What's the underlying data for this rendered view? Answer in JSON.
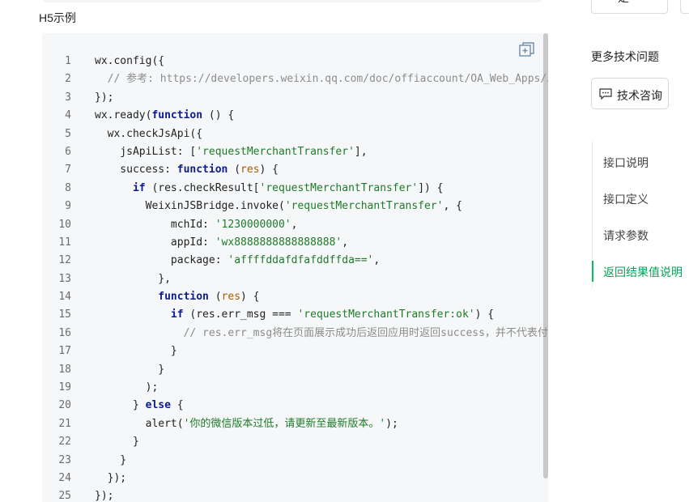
{
  "section": {
    "title": "H5示例"
  },
  "code": {
    "lines": [
      {
        "n": "1",
        "html": "<span class=\"pl\">wx.config({</span>"
      },
      {
        "n": "2",
        "html": "<span class=\"cmt\">  // 参考: https://developers.weixin.qq.com/doc/offiaccount/OA_Web_Apps/JS-SDK.html</span>"
      },
      {
        "n": "3",
        "html": "<span class=\"pl\">});</span>"
      },
      {
        "n": "4",
        "html": "<span class=\"pl\">wx.ready(</span><span class=\"kw\">function</span><span class=\"pl\"> () {</span>"
      },
      {
        "n": "5",
        "html": "<span class=\"pl\">  wx.checkJsApi({</span>"
      },
      {
        "n": "6",
        "html": "<span class=\"pl\">    jsApiList: [</span><span class=\"str\">'requestMerchantTransfer'</span><span class=\"pl\">],</span>"
      },
      {
        "n": "7",
        "html": "<span class=\"pl\">    success: </span><span class=\"kw\">function</span><span class=\"pl\"> (</span><span class=\"param\">res</span><span class=\"pl\">) {</span>"
      },
      {
        "n": "8",
        "html": "<span class=\"kw\">      if</span><span class=\"pl\"> (res.checkResult[</span><span class=\"str\">'requestMerchantTransfer'</span><span class=\"pl\">]) {</span>"
      },
      {
        "n": "9",
        "html": "<span class=\"pl\">        WeixinJSBridge.invoke(</span><span class=\"str\">'requestMerchantTransfer'</span><span class=\"pl\">, {</span>"
      },
      {
        "n": "10",
        "html": "<span class=\"pl\">            mchId: </span><span class=\"str\">'1230000000'</span><span class=\"pl\">,</span>"
      },
      {
        "n": "11",
        "html": "<span class=\"pl\">            appId: </span><span class=\"str\">'wx8888888888888888'</span><span class=\"pl\">,</span>"
      },
      {
        "n": "12",
        "html": "<span class=\"pl\">            package: </span><span class=\"str\">'affffddafdfafddffda=='</span><span class=\"pl\">,</span>"
      },
      {
        "n": "13",
        "html": "<span class=\"pl\">          },</span>"
      },
      {
        "n": "14",
        "html": "<span class=\"kw\">          function</span><span class=\"pl\"> (</span><span class=\"param\">res</span><span class=\"pl\">) {</span>"
      },
      {
        "n": "15",
        "html": "<span class=\"kw\">            if</span><span class=\"pl\"> (res.err_msg === </span><span class=\"str\">'requestMerchantTransfer:ok'</span><span class=\"pl\">) {</span>"
      },
      {
        "n": "16",
        "html": "<span class=\"cmt\">              // res.err_msg将在页面展示成功后返回应用时返回success，并不代表付款成功</span>"
      },
      {
        "n": "17",
        "html": "<span class=\"pl\">            }</span>"
      },
      {
        "n": "18",
        "html": "<span class=\"pl\">          }</span>"
      },
      {
        "n": "19",
        "html": "<span class=\"pl\">        );</span>"
      },
      {
        "n": "20",
        "html": "<span class=\"pl\">      } </span><span class=\"kw\">else</span><span class=\"pl\"> {</span>"
      },
      {
        "n": "21",
        "html": "<span class=\"pl\">        alert(</span><span class=\"str\">'你的微信版本过低，请更新至最新版本。'</span><span class=\"pl\">);</span>"
      },
      {
        "n": "22",
        "html": "<span class=\"pl\">      }</span>"
      },
      {
        "n": "23",
        "html": "<span class=\"pl\">    }</span>"
      },
      {
        "n": "24",
        "html": "<span class=\"pl\">  });</span>"
      },
      {
        "n": "25",
        "html": "<span class=\"pl\">});</span>"
      }
    ]
  },
  "sidebar": {
    "top_button": "是",
    "more_title": "更多技术问题",
    "consult_label": "技术咨询",
    "toc": [
      "接口说明",
      "接口定义",
      "请求参数",
      "返回结果值说明"
    ],
    "toc_active_index": 3,
    "accent_color": "#07c160"
  },
  "icons": {
    "copy": "copy-icon",
    "chat": "chat-icon"
  }
}
